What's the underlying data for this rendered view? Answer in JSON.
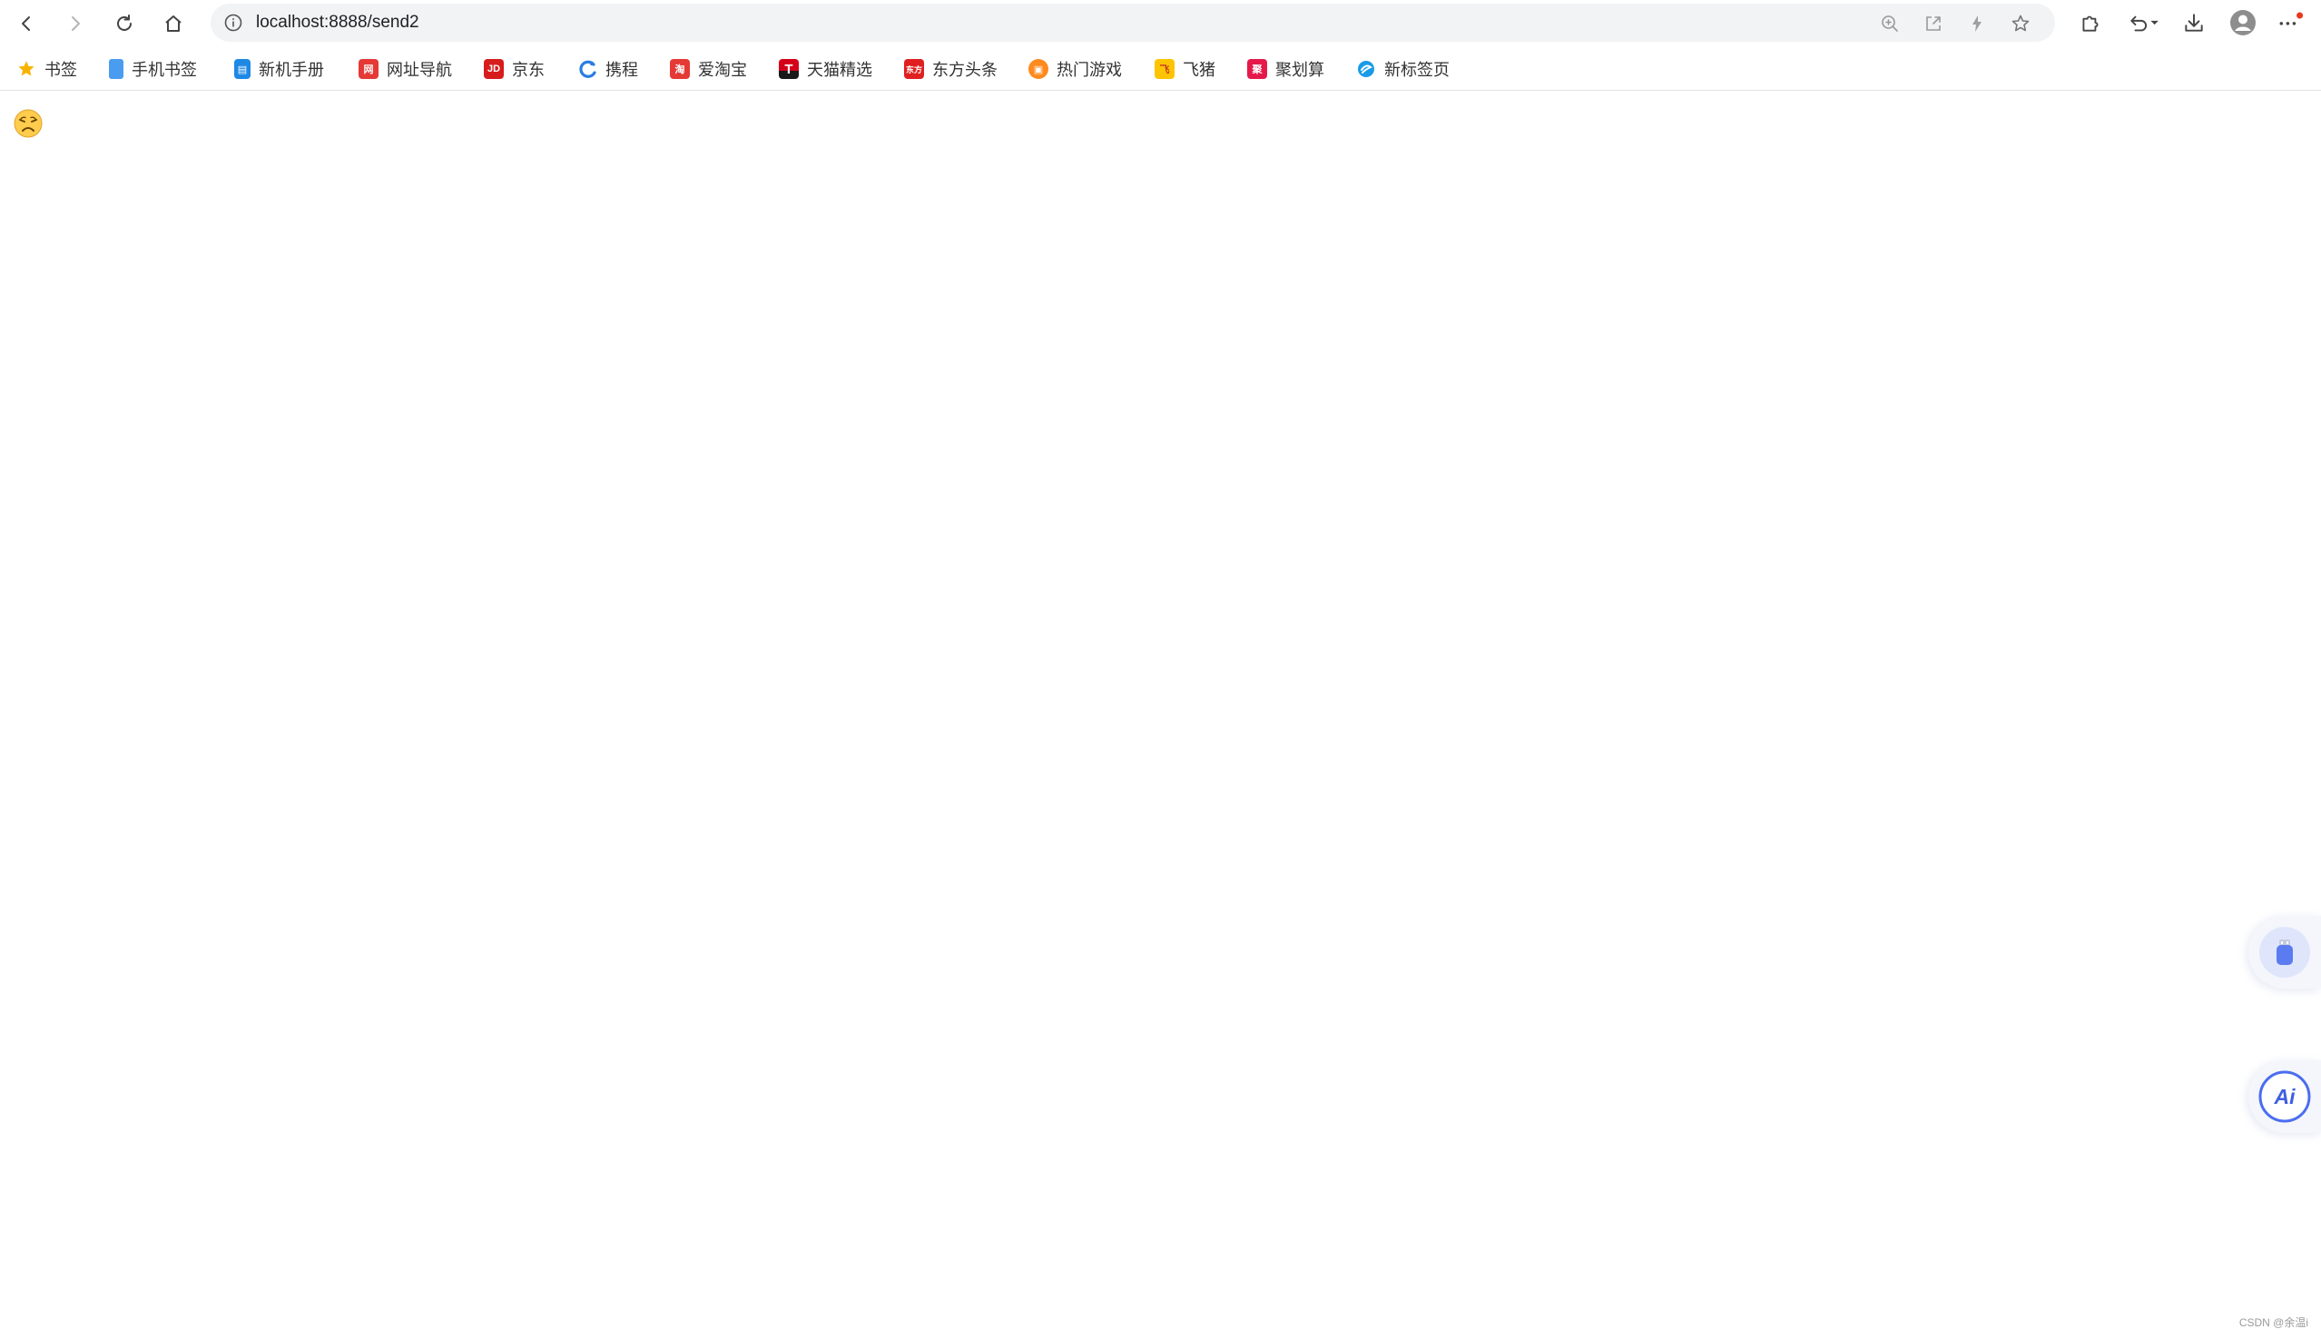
{
  "browser": {
    "url": "localhost:8888/send2",
    "buttons": [
      "back-icon",
      "forward-icon",
      "reload-icon",
      "home-icon"
    ],
    "omnibox_icons": [
      "zoom-icon",
      "share-icon",
      "flash-icon",
      "star-icon"
    ],
    "toolbar_icons": [
      "extensions-icon",
      "undo-icon",
      "download-icon",
      "profile-icon",
      "more-icon"
    ]
  },
  "bookmarks": [
    {
      "label": "书签",
      "icon": "star-icon",
      "color": "#f6b400"
    },
    {
      "label": "手机书签",
      "icon": "phone-icon",
      "color": "#4a9cf0"
    },
    {
      "label": "新机手册",
      "icon": "book-icon",
      "color": "#1e88e5"
    },
    {
      "label": "网址导航",
      "icon": "nav-icon",
      "color": "#e53935"
    },
    {
      "label": "京东",
      "icon": "jd-icon",
      "color": "#d71c1c"
    },
    {
      "label": "携程",
      "icon": "ctrip-icon",
      "color": "#2a7de1"
    },
    {
      "label": "爱淘宝",
      "icon": "taobao-icon",
      "color": "#e53935"
    },
    {
      "label": "天猫精选",
      "icon": "tmall-icon",
      "color": "#d4001a"
    },
    {
      "label": "东方头条",
      "icon": "dftt-icon",
      "color": "#e02020"
    },
    {
      "label": "热门游戏",
      "icon": "game-icon",
      "color": "#ff8a1e"
    },
    {
      "label": "飞猪",
      "icon": "fliggy-icon",
      "color": "#ffc400"
    },
    {
      "label": "聚划算",
      "icon": "juhuasuan-icon",
      "color": "#e6194b"
    },
    {
      "label": "新标签页",
      "icon": "newtab-icon",
      "color": "#1a9be8"
    }
  ],
  "page": {
    "emoji": "😣"
  },
  "watermark": "CSDN @余温i"
}
